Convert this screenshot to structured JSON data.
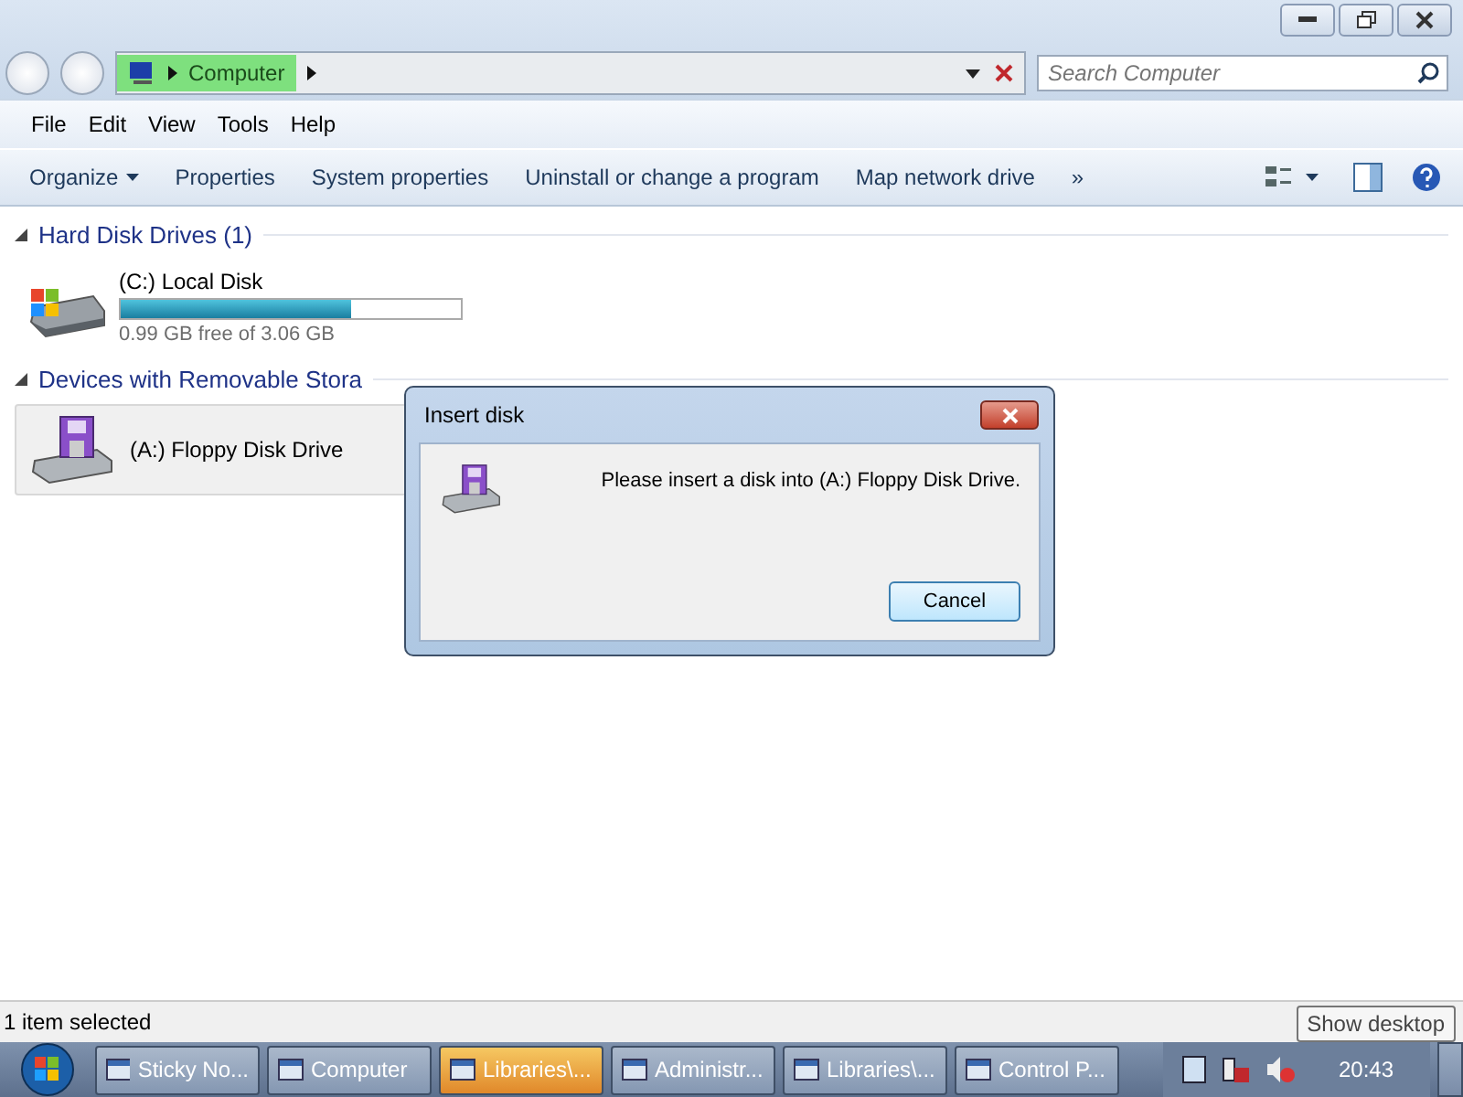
{
  "address_bar": {
    "location": "Computer"
  },
  "search": {
    "placeholder": "Search Computer"
  },
  "menu": [
    "File",
    "Edit",
    "View",
    "Tools",
    "Help"
  ],
  "commands": [
    "Organize",
    "Properties",
    "System properties",
    "Uninstall or change a program",
    "Map network drive",
    "»"
  ],
  "groups": [
    {
      "title": "Hard Disk Drives (1)",
      "items": [
        {
          "kind": "disk",
          "name": "(C:) Local Disk",
          "level": 0.68,
          "space": "0.99 GB free of 3.06 GB",
          "selected": false
        }
      ]
    },
    {
      "title": "Devices with Removable Stora",
      "items": [
        {
          "kind": "floppy",
          "name": "(A:) Floppy Disk Drive",
          "selected": true
        }
      ]
    }
  ],
  "dialog": {
    "title": "Insert disk",
    "message": "Please insert a disk into (A:) Floppy Disk Drive.",
    "button": "Cancel"
  },
  "status_bar": {
    "text": "1 item selected"
  },
  "tooltip": "Show desktop",
  "taskbar": [
    {
      "label": "Sticky No...",
      "flashing": false
    },
    {
      "label": "Computer",
      "flashing": false
    },
    {
      "label": "Libraries\\...",
      "flashing": true
    },
    {
      "label": "Administr...",
      "flashing": false
    },
    {
      "label": "Libraries\\...",
      "flashing": false
    },
    {
      "label": "Control P...",
      "flashing": false
    }
  ],
  "clock": "20:43"
}
